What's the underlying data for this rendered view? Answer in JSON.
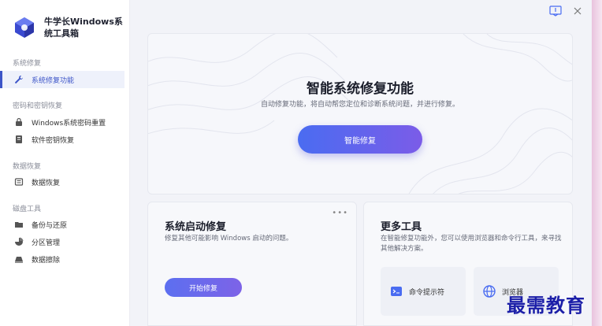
{
  "app": {
    "title": "牛学长Windows系统工具箱"
  },
  "colors": {
    "accent": "#3d55c8",
    "button_gradient_start": "#4a6cf1",
    "button_gradient_end": "#7b5ce8",
    "watermark": "#1c1fa8"
  },
  "sidebar": {
    "sections": [
      {
        "title": "系统修复",
        "items": [
          {
            "label": "系统修复功能",
            "icon": "wrench-icon",
            "active": true
          }
        ]
      },
      {
        "title": "密码和密钥恢复",
        "items": [
          {
            "label": "Windows系统密码重置",
            "icon": "lock-icon"
          },
          {
            "label": "软件密钥恢复",
            "icon": "document-icon"
          }
        ]
      },
      {
        "title": "数据恢复",
        "items": [
          {
            "label": "数据恢复",
            "icon": "drive-icon"
          }
        ]
      },
      {
        "title": "磁盘工具",
        "items": [
          {
            "label": "备份与还原",
            "icon": "folder-icon"
          },
          {
            "label": "分区管理",
            "icon": "pie-icon"
          },
          {
            "label": "数据擦除",
            "icon": "eraser-icon"
          }
        ]
      }
    ]
  },
  "hero": {
    "title": "智能系统修复功能",
    "description": "自动修复功能，将自动帮您定位和诊断系统问题，并进行修复。",
    "button": "智能修复"
  },
  "boot_repair": {
    "title": "系统启动修复",
    "description": "修复其他可能影响 Windows 启动的问题。",
    "button": "开始修复",
    "more_icon": "more-dots-icon"
  },
  "more_tools": {
    "title": "更多工具",
    "description": "在智能修复功能外，您可以使用浏览器和命令行工具，来寻找其他解决方案。",
    "tools": [
      {
        "label": "命令提示符",
        "icon": "terminal-icon"
      },
      {
        "label": "浏览器",
        "icon": "globe-icon"
      }
    ]
  },
  "watermark": "最需教育"
}
